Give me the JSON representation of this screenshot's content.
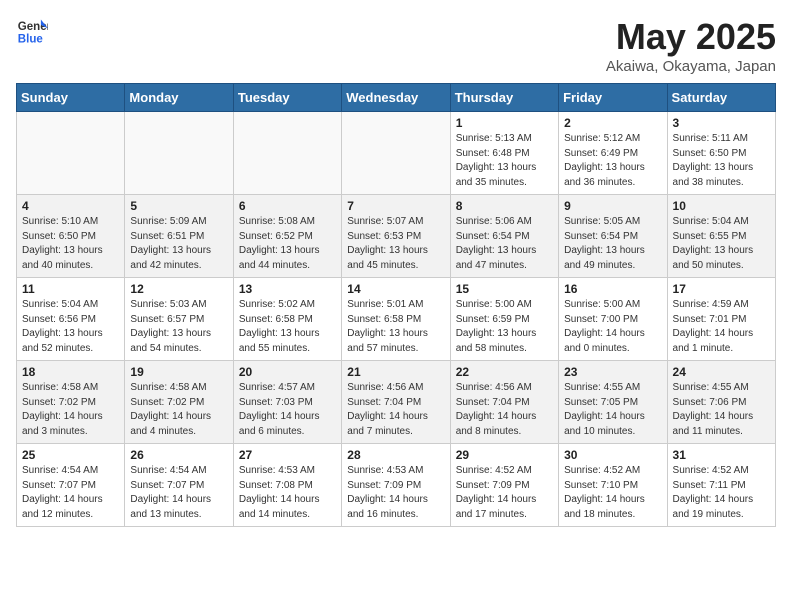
{
  "header": {
    "logo_general": "General",
    "logo_blue": "Blue",
    "month": "May 2025",
    "location": "Akaiwa, Okayama, Japan"
  },
  "weekdays": [
    "Sunday",
    "Monday",
    "Tuesday",
    "Wednesday",
    "Thursday",
    "Friday",
    "Saturday"
  ],
  "weeks": [
    [
      {
        "day": "",
        "info": ""
      },
      {
        "day": "",
        "info": ""
      },
      {
        "day": "",
        "info": ""
      },
      {
        "day": "",
        "info": ""
      },
      {
        "day": "1",
        "info": "Sunrise: 5:13 AM\nSunset: 6:48 PM\nDaylight: 13 hours\nand 35 minutes."
      },
      {
        "day": "2",
        "info": "Sunrise: 5:12 AM\nSunset: 6:49 PM\nDaylight: 13 hours\nand 36 minutes."
      },
      {
        "day": "3",
        "info": "Sunrise: 5:11 AM\nSunset: 6:50 PM\nDaylight: 13 hours\nand 38 minutes."
      }
    ],
    [
      {
        "day": "4",
        "info": "Sunrise: 5:10 AM\nSunset: 6:50 PM\nDaylight: 13 hours\nand 40 minutes."
      },
      {
        "day": "5",
        "info": "Sunrise: 5:09 AM\nSunset: 6:51 PM\nDaylight: 13 hours\nand 42 minutes."
      },
      {
        "day": "6",
        "info": "Sunrise: 5:08 AM\nSunset: 6:52 PM\nDaylight: 13 hours\nand 44 minutes."
      },
      {
        "day": "7",
        "info": "Sunrise: 5:07 AM\nSunset: 6:53 PM\nDaylight: 13 hours\nand 45 minutes."
      },
      {
        "day": "8",
        "info": "Sunrise: 5:06 AM\nSunset: 6:54 PM\nDaylight: 13 hours\nand 47 minutes."
      },
      {
        "day": "9",
        "info": "Sunrise: 5:05 AM\nSunset: 6:54 PM\nDaylight: 13 hours\nand 49 minutes."
      },
      {
        "day": "10",
        "info": "Sunrise: 5:04 AM\nSunset: 6:55 PM\nDaylight: 13 hours\nand 50 minutes."
      }
    ],
    [
      {
        "day": "11",
        "info": "Sunrise: 5:04 AM\nSunset: 6:56 PM\nDaylight: 13 hours\nand 52 minutes."
      },
      {
        "day": "12",
        "info": "Sunrise: 5:03 AM\nSunset: 6:57 PM\nDaylight: 13 hours\nand 54 minutes."
      },
      {
        "day": "13",
        "info": "Sunrise: 5:02 AM\nSunset: 6:58 PM\nDaylight: 13 hours\nand 55 minutes."
      },
      {
        "day": "14",
        "info": "Sunrise: 5:01 AM\nSunset: 6:58 PM\nDaylight: 13 hours\nand 57 minutes."
      },
      {
        "day": "15",
        "info": "Sunrise: 5:00 AM\nSunset: 6:59 PM\nDaylight: 13 hours\nand 58 minutes."
      },
      {
        "day": "16",
        "info": "Sunrise: 5:00 AM\nSunset: 7:00 PM\nDaylight: 14 hours\nand 0 minutes."
      },
      {
        "day": "17",
        "info": "Sunrise: 4:59 AM\nSunset: 7:01 PM\nDaylight: 14 hours\nand 1 minute."
      }
    ],
    [
      {
        "day": "18",
        "info": "Sunrise: 4:58 AM\nSunset: 7:02 PM\nDaylight: 14 hours\nand 3 minutes."
      },
      {
        "day": "19",
        "info": "Sunrise: 4:58 AM\nSunset: 7:02 PM\nDaylight: 14 hours\nand 4 minutes."
      },
      {
        "day": "20",
        "info": "Sunrise: 4:57 AM\nSunset: 7:03 PM\nDaylight: 14 hours\nand 6 minutes."
      },
      {
        "day": "21",
        "info": "Sunrise: 4:56 AM\nSunset: 7:04 PM\nDaylight: 14 hours\nand 7 minutes."
      },
      {
        "day": "22",
        "info": "Sunrise: 4:56 AM\nSunset: 7:04 PM\nDaylight: 14 hours\nand 8 minutes."
      },
      {
        "day": "23",
        "info": "Sunrise: 4:55 AM\nSunset: 7:05 PM\nDaylight: 14 hours\nand 10 minutes."
      },
      {
        "day": "24",
        "info": "Sunrise: 4:55 AM\nSunset: 7:06 PM\nDaylight: 14 hours\nand 11 minutes."
      }
    ],
    [
      {
        "day": "25",
        "info": "Sunrise: 4:54 AM\nSunset: 7:07 PM\nDaylight: 14 hours\nand 12 minutes."
      },
      {
        "day": "26",
        "info": "Sunrise: 4:54 AM\nSunset: 7:07 PM\nDaylight: 14 hours\nand 13 minutes."
      },
      {
        "day": "27",
        "info": "Sunrise: 4:53 AM\nSunset: 7:08 PM\nDaylight: 14 hours\nand 14 minutes."
      },
      {
        "day": "28",
        "info": "Sunrise: 4:53 AM\nSunset: 7:09 PM\nDaylight: 14 hours\nand 16 minutes."
      },
      {
        "day": "29",
        "info": "Sunrise: 4:52 AM\nSunset: 7:09 PM\nDaylight: 14 hours\nand 17 minutes."
      },
      {
        "day": "30",
        "info": "Sunrise: 4:52 AM\nSunset: 7:10 PM\nDaylight: 14 hours\nand 18 minutes."
      },
      {
        "day": "31",
        "info": "Sunrise: 4:52 AM\nSunset: 7:11 PM\nDaylight: 14 hours\nand 19 minutes."
      }
    ]
  ]
}
